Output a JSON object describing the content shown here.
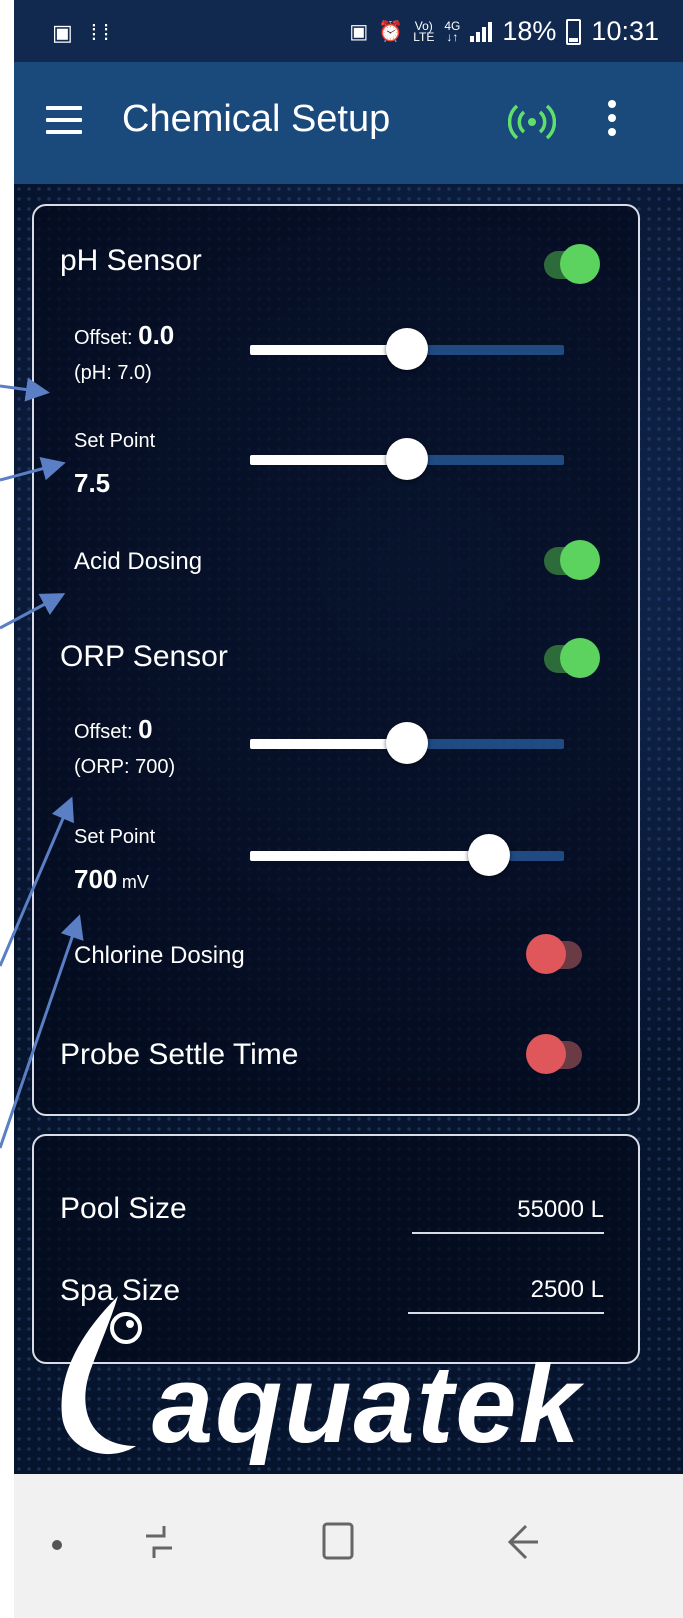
{
  "statusbar": {
    "volte_top": "Vo)",
    "volte_bottom": "LTE",
    "net_top": "4G",
    "net_bottom": "↓↑",
    "battery": "18%",
    "time": "10:31"
  },
  "appbar": {
    "title": "Chemical Setup"
  },
  "ph": {
    "title": "pH Sensor",
    "enabled": true,
    "offset_label": "Offset:",
    "offset_value": "0.0",
    "offset_sub": "(pH: 7.0)",
    "offset_slider_fraction": 0.5,
    "setpoint_label": "Set Point",
    "setpoint_value": "7.5",
    "setpoint_slider_fraction": 0.5,
    "acid_label": "Acid Dosing",
    "acid_enabled": true
  },
  "orp": {
    "title": "ORP Sensor",
    "enabled": true,
    "offset_label": "Offset:",
    "offset_value": "0",
    "offset_sub": "(ORP: 700)",
    "offset_slider_fraction": 0.5,
    "setpoint_label": "Set Point",
    "setpoint_value": "700",
    "setpoint_unit": "mV",
    "setpoint_slider_fraction": 0.76,
    "chlorine_label": "Chlorine Dosing",
    "chlorine_enabled": false
  },
  "probe": {
    "label": "Probe Settle Time",
    "enabled": false
  },
  "sizes": {
    "pool_label": "Pool Size",
    "pool_value": "55000 L",
    "spa_label": "Spa Size",
    "spa_value": "2500 L"
  },
  "logo": {
    "text": "aquatek"
  },
  "colors": {
    "toggle_on": "#5bd35e",
    "toggle_off": "#e0575b",
    "accent_connected": "#5ee06a",
    "appbar": "#1a4a7c"
  },
  "icons": [
    "menu-icon",
    "connection-icon",
    "more-vert-icon",
    "back-icon",
    "recents-icon",
    "home-icon"
  ]
}
